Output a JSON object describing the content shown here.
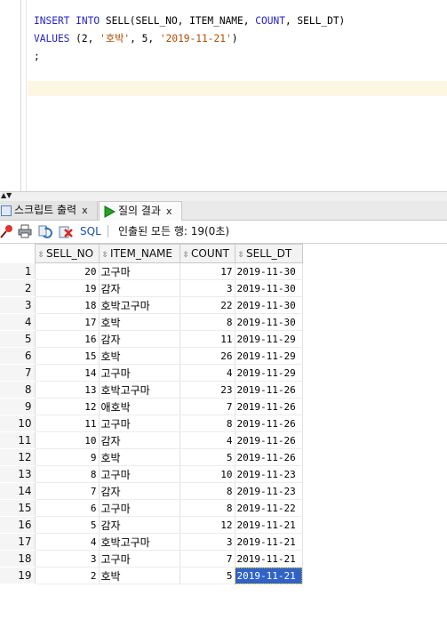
{
  "editor": {
    "line1": {
      "insert": "INSERT",
      "into": "INTO",
      "rest": " SELL(SELL_NO, ITEM_NAME, ",
      "count": "COUNT",
      "rest2": ", SELL_DT)"
    },
    "line2": {
      "values": "VALUES",
      "open": " (2, ",
      "item": "'호박'",
      "mid": ", 5, ",
      "date": "'2019-11-21'",
      "close": ")"
    },
    "line3": ";"
  },
  "tabs": [
    {
      "label": "스크립트 출력",
      "close": "x",
      "icon": "script-output-icon"
    },
    {
      "label": "질의 결과",
      "close": "x",
      "icon": "run-icon"
    }
  ],
  "toolbar": {
    "sql_label": "SQL",
    "separator": "|",
    "status": "인출된 모든 행: 19(0초)",
    "icons": [
      "pin-icon",
      "print-icon",
      "refresh-icon",
      "export-icon"
    ]
  },
  "grid": {
    "columns": [
      "SELL_NO",
      "ITEM_NAME",
      "COUNT",
      "SELL_DT"
    ],
    "rows": [
      {
        "n": "1",
        "sell_no": "20",
        "item": "고구마",
        "count": "17",
        "date": "2019-11-30"
      },
      {
        "n": "2",
        "sell_no": "19",
        "item": "감자",
        "count": "3",
        "date": "2019-11-30"
      },
      {
        "n": "3",
        "sell_no": "18",
        "item": "호박고구마",
        "count": "22",
        "date": "2019-11-30"
      },
      {
        "n": "4",
        "sell_no": "17",
        "item": "호박",
        "count": "8",
        "date": "2019-11-30"
      },
      {
        "n": "5",
        "sell_no": "16",
        "item": "감자",
        "count": "11",
        "date": "2019-11-29"
      },
      {
        "n": "6",
        "sell_no": "15",
        "item": "호박",
        "count": "26",
        "date": "2019-11-29"
      },
      {
        "n": "7",
        "sell_no": "14",
        "item": "고구마",
        "count": "4",
        "date": "2019-11-29"
      },
      {
        "n": "8",
        "sell_no": "13",
        "item": "호박고구마",
        "count": "23",
        "date": "2019-11-26"
      },
      {
        "n": "9",
        "sell_no": "12",
        "item": "애호박",
        "count": "7",
        "date": "2019-11-26"
      },
      {
        "n": "10",
        "sell_no": "11",
        "item": "고구마",
        "count": "8",
        "date": "2019-11-26"
      },
      {
        "n": "11",
        "sell_no": "10",
        "item": "감자",
        "count": "4",
        "date": "2019-11-26"
      },
      {
        "n": "12",
        "sell_no": "9",
        "item": "호박",
        "count": "5",
        "date": "2019-11-26"
      },
      {
        "n": "13",
        "sell_no": "8",
        "item": "고구마",
        "count": "10",
        "date": "2019-11-23"
      },
      {
        "n": "14",
        "sell_no": "7",
        "item": "감자",
        "count": "8",
        "date": "2019-11-23"
      },
      {
        "n": "15",
        "sell_no": "6",
        "item": "고구마",
        "count": "8",
        "date": "2019-11-22"
      },
      {
        "n": "16",
        "sell_no": "5",
        "item": "감자",
        "count": "12",
        "date": "2019-11-21"
      },
      {
        "n": "17",
        "sell_no": "4",
        "item": "호박고구마",
        "count": "3",
        "date": "2019-11-21"
      },
      {
        "n": "18",
        "sell_no": "3",
        "item": "고구마",
        "count": "7",
        "date": "2019-11-21"
      },
      {
        "n": "19",
        "sell_no": "2",
        "item": "호박",
        "count": "5",
        "date": "2019-11-21"
      }
    ],
    "selected_cell": {
      "row": 19,
      "column": "SELL_DT"
    }
  },
  "colors": {
    "keyword": "#2323c8",
    "string": "#b24b00",
    "selection": "#2f63c9",
    "current_line": "#fdf6e3",
    "sql_label": "#1a50b0"
  }
}
